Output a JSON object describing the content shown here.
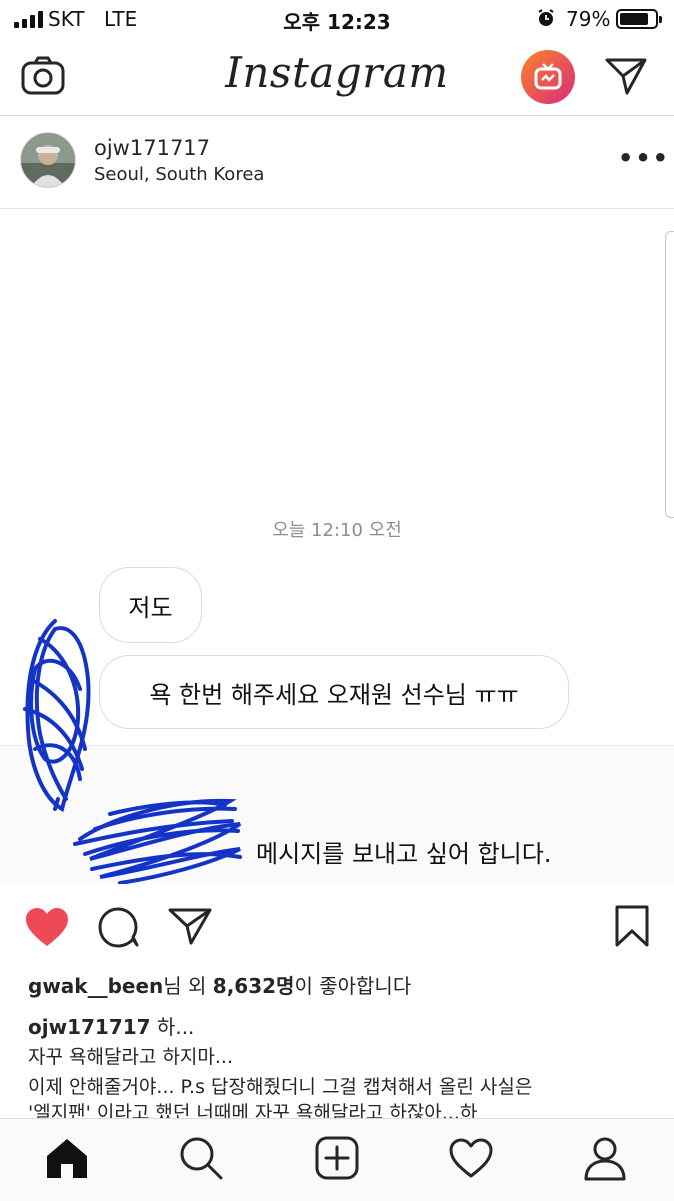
{
  "status_bar": {
    "carrier": "SKT",
    "network": "LTE",
    "time": "오후 12:23",
    "battery_percent": "79%",
    "battery_level": 0.79
  },
  "top_nav": {
    "logo_text": "Instagram",
    "icons": [
      "camera-icon",
      "igtv-icon",
      "direct-send-icon"
    ],
    "igtv_gradient": [
      "#f58529",
      "#dd2a7b"
    ]
  },
  "post": {
    "username": "ojw171717",
    "location": "Seoul, South Korea",
    "more_label": "•••"
  },
  "post_image": {
    "timestamp": "오늘 12:10 오전",
    "bubbles": [
      "저도",
      "욕 한번 해주세요 오재원 선수님 ㅠㅠ"
    ],
    "request_text": "메시지를 보내고 싶어 합니다.",
    "scribble_color": "#1434c8"
  },
  "actions": {
    "icons": [
      "heart-icon",
      "comment-icon",
      "share-icon",
      "bookmark-icon"
    ],
    "liked_color": "#ed4956"
  },
  "likes": {
    "user": "gwak__been",
    "prefix": "님 외 ",
    "count": "8,632명",
    "suffix": "이 좋아합니다"
  },
  "caption": {
    "username": "ojw171717",
    "line1": " 하...",
    "line2": "자꾸 욕해달라고 하지마...",
    "line3": "이제 안해줄거야... P.s 답장해줬더니 그걸 캡쳐해서 올린  사실은",
    "line4": "'엘지팬' 이라고 했던 너때메  자꾸 욕해달라고 하잖아...하"
  },
  "tab_bar": {
    "icons": [
      "home-icon",
      "search-icon",
      "new-post-icon",
      "activity-heart-icon",
      "profile-icon"
    ]
  }
}
